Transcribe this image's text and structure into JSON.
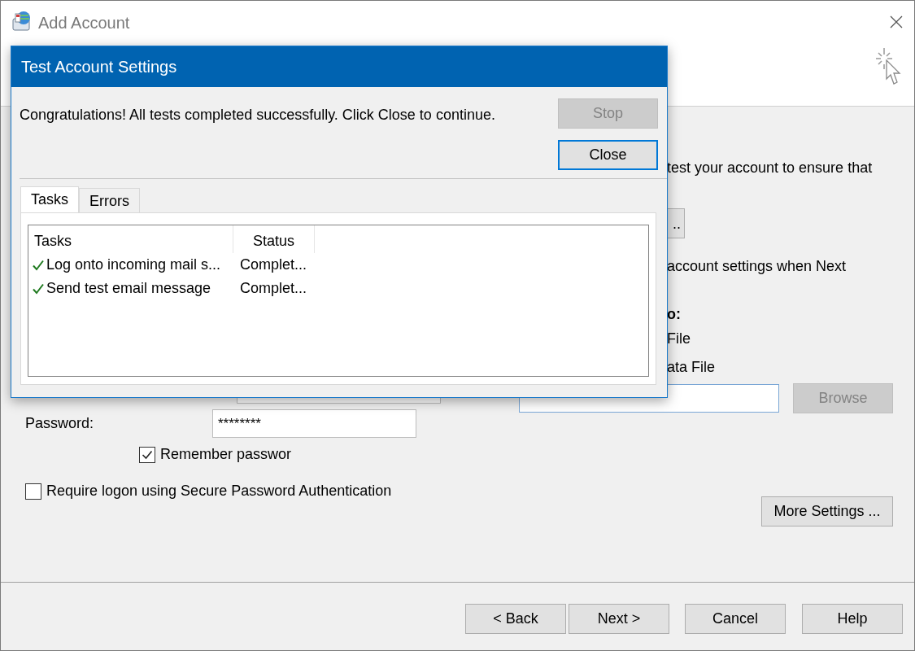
{
  "window": {
    "title": "Add Account"
  },
  "form": {
    "right_column": [
      {
        "kind": "text",
        "text": "test your account to ensure that"
      },
      {
        "kind": "button",
        "text": ".."
      },
      {
        "kind": "text",
        "text": "account settings when Next"
      },
      {
        "kind": "heading",
        "text": "o:"
      },
      {
        "kind": "text",
        "text": "File"
      },
      {
        "kind": "text",
        "text": "ata File"
      }
    ],
    "browse_button": {
      "label": "Browse",
      "disabled": true
    },
    "more_settings_button": {
      "label": "More Settings ...",
      "disabled": false
    },
    "password": {
      "label": "Password:",
      "value": "********"
    },
    "remember_password": {
      "label": "Remember passwor",
      "checked": true
    },
    "secure_auth": {
      "label": "Require logon using Secure Password Authentication",
      "checked": false
    }
  },
  "buttons": [
    {
      "label": "< Back"
    },
    {
      "label": "Next >"
    },
    {
      "label": "Cancel"
    },
    {
      "label": "Help"
    }
  ],
  "dialog": {
    "title": "Test Account Settings",
    "message": "Congratulations! All tests completed successfully. Click Close to continue.",
    "stop_button": {
      "label": "Stop",
      "disabled": true
    },
    "close_button": {
      "label": "Close",
      "disabled": false,
      "default": true
    },
    "tabs": [
      {
        "label": "Tasks",
        "selected": true
      },
      {
        "label": "Errors",
        "selected": false
      }
    ],
    "table": {
      "columns": [
        "Tasks",
        "Status"
      ],
      "rows": [
        {
          "task": "Log onto incoming mail s...",
          "status": "Complet...",
          "done": true
        },
        {
          "task": "Send test email message",
          "status": "Complet...",
          "done": true
        }
      ]
    }
  }
}
